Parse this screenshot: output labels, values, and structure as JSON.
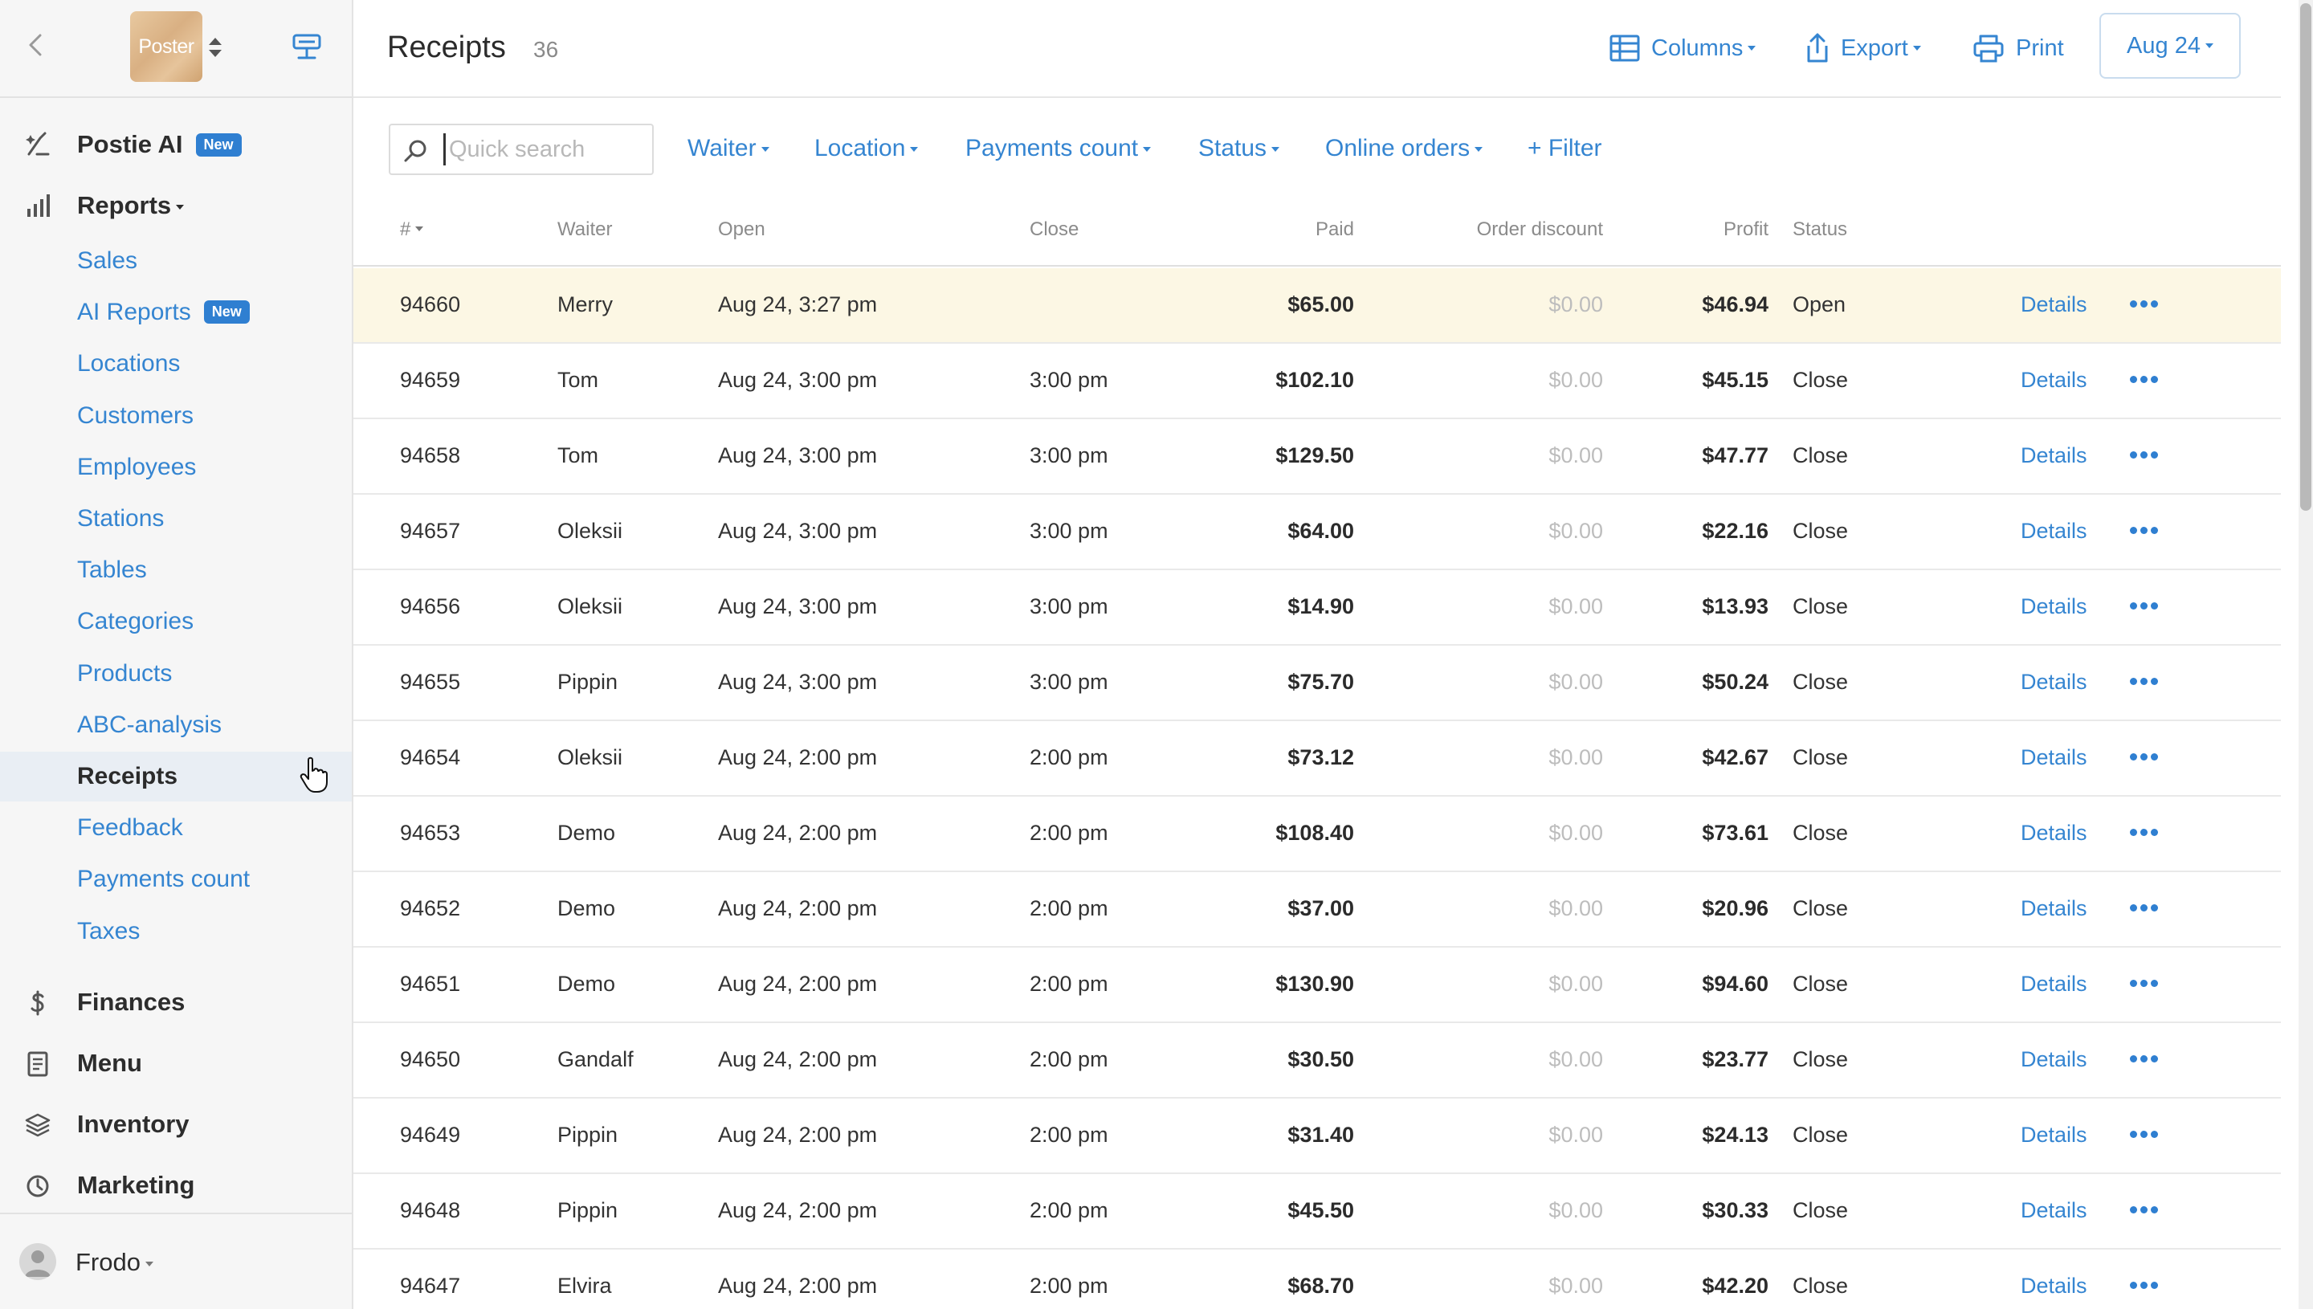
{
  "sidebar": {
    "logo_text": "Poster",
    "nav": [
      {
        "label": "Postie AI",
        "badge": "New"
      },
      {
        "label": "Reports"
      }
    ],
    "reports_sub": [
      {
        "label": "Sales"
      },
      {
        "label": "AI Reports",
        "badge": "New"
      },
      {
        "label": "Locations"
      },
      {
        "label": "Customers"
      },
      {
        "label": "Employees"
      },
      {
        "label": "Stations"
      },
      {
        "label": "Tables"
      },
      {
        "label": "Categories"
      },
      {
        "label": "Products"
      },
      {
        "label": "ABC-analysis"
      },
      {
        "label": "Receipts",
        "active": true
      },
      {
        "label": "Feedback"
      },
      {
        "label": "Payments count"
      },
      {
        "label": "Taxes"
      }
    ],
    "bottom_nav": [
      {
        "label": "Finances",
        "icon": "dollar-icon"
      },
      {
        "label": "Menu",
        "icon": "document-icon"
      },
      {
        "label": "Inventory",
        "icon": "layers-icon"
      },
      {
        "label": "Marketing",
        "icon": "clock-icon"
      }
    ],
    "user": {
      "name": "Frodo"
    }
  },
  "header": {
    "title": "Receipts",
    "count": "36",
    "buttons": {
      "columns": "Columns",
      "export": "Export",
      "print": "Print",
      "date": "Aug 24"
    }
  },
  "filters": {
    "search_placeholder": "Quick search",
    "items": [
      "Waiter",
      "Location",
      "Payments count",
      "Status",
      "Online orders"
    ],
    "add": "+ Filter"
  },
  "table": {
    "columns": {
      "num": "#",
      "waiter": "Waiter",
      "open": "Open",
      "close": "Close",
      "paid": "Paid",
      "discount": "Order discount",
      "profit": "Profit",
      "status": "Status"
    },
    "details_label": "Details",
    "rows": [
      {
        "num": "94660",
        "waiter": "Merry",
        "open": "Aug 24, 3:27 pm",
        "close": "",
        "paid": "$65.00",
        "discount": "$0.00",
        "profit": "$46.94",
        "status": "Open",
        "highlight": true
      },
      {
        "num": "94659",
        "waiter": "Tom",
        "open": "Aug 24, 3:00 pm",
        "close": "3:00 pm",
        "paid": "$102.10",
        "discount": "$0.00",
        "profit": "$45.15",
        "status": "Close"
      },
      {
        "num": "94658",
        "waiter": "Tom",
        "open": "Aug 24, 3:00 pm",
        "close": "3:00 pm",
        "paid": "$129.50",
        "discount": "$0.00",
        "profit": "$47.77",
        "status": "Close"
      },
      {
        "num": "94657",
        "waiter": "Oleksii",
        "open": "Aug 24, 3:00 pm",
        "close": "3:00 pm",
        "paid": "$64.00",
        "discount": "$0.00",
        "profit": "$22.16",
        "status": "Close"
      },
      {
        "num": "94656",
        "waiter": "Oleksii",
        "open": "Aug 24, 3:00 pm",
        "close": "3:00 pm",
        "paid": "$14.90",
        "discount": "$0.00",
        "profit": "$13.93",
        "status": "Close"
      },
      {
        "num": "94655",
        "waiter": "Pippin",
        "open": "Aug 24, 3:00 pm",
        "close": "3:00 pm",
        "paid": "$75.70",
        "discount": "$0.00",
        "profit": "$50.24",
        "status": "Close"
      },
      {
        "num": "94654",
        "waiter": "Oleksii",
        "open": "Aug 24, 2:00 pm",
        "close": "2:00 pm",
        "paid": "$73.12",
        "discount": "$0.00",
        "profit": "$42.67",
        "status": "Close"
      },
      {
        "num": "94653",
        "waiter": "Demo",
        "open": "Aug 24, 2:00 pm",
        "close": "2:00 pm",
        "paid": "$108.40",
        "discount": "$0.00",
        "profit": "$73.61",
        "status": "Close"
      },
      {
        "num": "94652",
        "waiter": "Demo",
        "open": "Aug 24, 2:00 pm",
        "close": "2:00 pm",
        "paid": "$37.00",
        "discount": "$0.00",
        "profit": "$20.96",
        "status": "Close"
      },
      {
        "num": "94651",
        "waiter": "Demo",
        "open": "Aug 24, 2:00 pm",
        "close": "2:00 pm",
        "paid": "$130.90",
        "discount": "$0.00",
        "profit": "$94.60",
        "status": "Close"
      },
      {
        "num": "94650",
        "waiter": "Gandalf",
        "open": "Aug 24, 2:00 pm",
        "close": "2:00 pm",
        "paid": "$30.50",
        "discount": "$0.00",
        "profit": "$23.77",
        "status": "Close"
      },
      {
        "num": "94649",
        "waiter": "Pippin",
        "open": "Aug 24, 2:00 pm",
        "close": "2:00 pm",
        "paid": "$31.40",
        "discount": "$0.00",
        "profit": "$24.13",
        "status": "Close"
      },
      {
        "num": "94648",
        "waiter": "Pippin",
        "open": "Aug 24, 2:00 pm",
        "close": "2:00 pm",
        "paid": "$45.50",
        "discount": "$0.00",
        "profit": "$30.33",
        "status": "Close"
      },
      {
        "num": "94647",
        "waiter": "Elvira",
        "open": "Aug 24, 2:00 pm",
        "close": "2:00 pm",
        "paid": "$68.70",
        "discount": "$0.00",
        "profit": "$42.20",
        "status": "Close"
      }
    ]
  },
  "colors": {
    "accent": "#3585d1",
    "highlight_row": "#fcf7e4",
    "sidebar_bg": "#f6f6f6"
  }
}
